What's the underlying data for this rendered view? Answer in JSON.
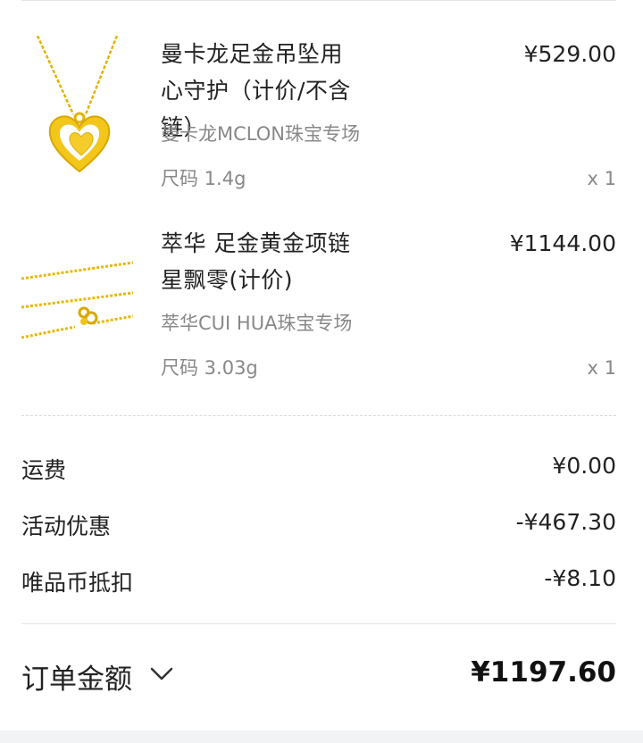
{
  "items": [
    {
      "title": "曼卡龙足金吊坠用心守护（计价/不含链）",
      "price": "¥529.00",
      "store": "曼卡龙MCLON珠宝专场",
      "spec": "尺码 1.4g",
      "qty": "x 1"
    },
    {
      "title": "萃华 足金黄金项链星飘零(计价)",
      "price": "¥1144.00",
      "store": "萃华CUI HUA珠宝专场",
      "spec": "尺码 3.03g",
      "qty": "x 1"
    }
  ],
  "fees": [
    {
      "label": "运费",
      "value": "¥0.00"
    },
    {
      "label": "活动优惠",
      "value": "-¥467.30"
    },
    {
      "label": "唯品币抵扣",
      "value": "-¥8.10"
    }
  ],
  "total": {
    "label": "订单金额",
    "amount": "¥1197.60"
  },
  "icons": {
    "pendant": "heart-pendant-image",
    "chain": "gold-chain-image",
    "chevron": "chevron-down-icon"
  },
  "colors": {
    "gold": "#f2c200",
    "text": "#222222",
    "muted": "#888888"
  }
}
